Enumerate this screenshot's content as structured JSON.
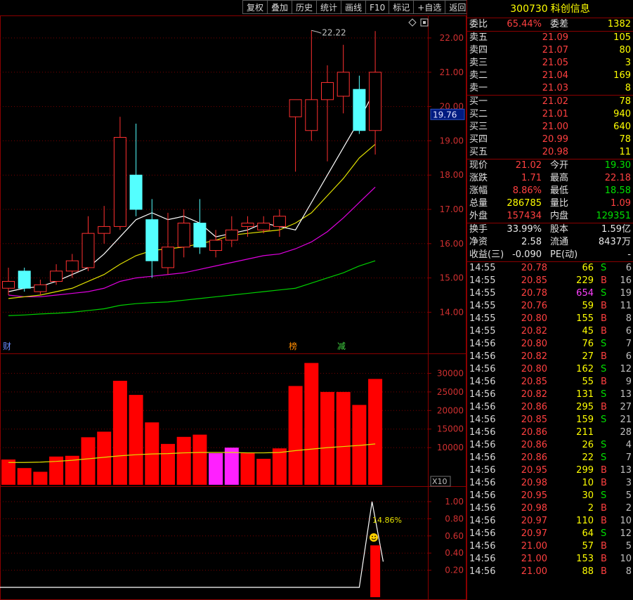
{
  "toolbar": {
    "buttons": [
      "复权",
      "叠加",
      "历史",
      "统计",
      "画线",
      "F10",
      "标记",
      "+自选",
      "返回"
    ]
  },
  "stock": {
    "code": "300730",
    "name": "科创信息"
  },
  "price_axis": {
    "labels": [
      "22.00",
      "21.00",
      "20.00",
      "19.00",
      "18.00",
      "17.00",
      "16.00",
      "15.00",
      "14.00"
    ],
    "current_marker": "19.76"
  },
  "volume_axis": {
    "labels": [
      "30000",
      "25000",
      "20000",
      "15000",
      "10000"
    ],
    "unit": "X10"
  },
  "indicator_axis": {
    "labels": [
      "1.00",
      "0.80",
      "0.60",
      "0.40",
      "0.20"
    ]
  },
  "annotations": {
    "high_label": "22.22",
    "indicator_value": "14.86%",
    "marker_cai": "财",
    "marker_bang": "榜",
    "marker_jian": "减"
  },
  "chart_data": {
    "type": "candlestick",
    "ylim": [
      13.0,
      22.6
    ],
    "candles": [
      {
        "o": 14.7,
        "c": 14.9,
        "h": 15.3,
        "l": 14.5
      },
      {
        "o": 15.2,
        "c": 14.7,
        "h": 15.3,
        "l": 14.6
      },
      {
        "o": 14.6,
        "c": 14.8,
        "h": 14.95,
        "l": 14.5
      },
      {
        "o": 14.9,
        "c": 15.2,
        "h": 15.4,
        "l": 14.8
      },
      {
        "o": 15.2,
        "c": 15.5,
        "h": 15.7,
        "l": 15.0
      },
      {
        "o": 15.3,
        "c": 16.3,
        "h": 16.8,
        "l": 15.2
      },
      {
        "o": 16.3,
        "c": 16.5,
        "h": 17.1,
        "l": 16.0
      },
      {
        "o": 16.5,
        "c": 19.1,
        "h": 19.7,
        "l": 16.4
      },
      {
        "o": 18.0,
        "c": 17.0,
        "h": 19.5,
        "l": 16.8
      },
      {
        "o": 16.7,
        "c": 15.5,
        "h": 17.3,
        "l": 15.0
      },
      {
        "o": 15.3,
        "c": 15.9,
        "h": 16.9,
        "l": 15.1
      },
      {
        "o": 15.9,
        "c": 16.6,
        "h": 17.0,
        "l": 15.6
      },
      {
        "o": 16.6,
        "c": 15.9,
        "h": 17.3,
        "l": 15.7
      },
      {
        "o": 15.8,
        "c": 16.1,
        "h": 16.4,
        "l": 15.6
      },
      {
        "o": 16.1,
        "c": 16.4,
        "h": 16.8,
        "l": 15.9
      },
      {
        "o": 16.5,
        "c": 16.6,
        "h": 16.8,
        "l": 16.2
      },
      {
        "o": 16.4,
        "c": 16.6,
        "h": 16.8,
        "l": 16.3
      },
      {
        "o": 16.5,
        "c": 16.8,
        "h": 17.0,
        "l": 16.2
      },
      {
        "o": 19.7,
        "c": 20.2,
        "h": 20.2,
        "l": 18.1
      },
      {
        "o": 19.3,
        "c": 20.2,
        "h": 22.22,
        "l": 19.0
      },
      {
        "o": 20.2,
        "c": 20.7,
        "h": 21.2,
        "l": 18.4
      },
      {
        "o": 20.3,
        "c": 21.0,
        "h": 21.8,
        "l": 19.8
      },
      {
        "o": 20.5,
        "c": 19.3,
        "h": 20.9,
        "l": 19.2
      },
      {
        "o": 19.3,
        "c": 21.0,
        "h": 22.2,
        "l": 18.6
      }
    ],
    "ma_fast": [
      14.6,
      14.7,
      14.75,
      14.9,
      15.1,
      15.3,
      15.7,
      16.2,
      16.7,
      16.9,
      16.7,
      16.8,
      16.6,
      16.2,
      16.3,
      16.4,
      16.6,
      16.5,
      16.4,
      17.2,
      18.0,
      18.8,
      19.6,
      20.5
    ],
    "ma_mid": [
      14.4,
      14.45,
      14.5,
      14.6,
      14.7,
      14.9,
      15.1,
      15.4,
      15.65,
      15.8,
      15.85,
      15.9,
      16.0,
      16.1,
      16.25,
      16.3,
      16.35,
      16.4,
      16.6,
      16.9,
      17.4,
      17.9,
      18.5,
      18.9
    ],
    "ma_slow": [
      14.5,
      14.45,
      14.45,
      14.5,
      14.55,
      14.6,
      14.7,
      14.9,
      15.0,
      15.05,
      15.1,
      15.15,
      15.25,
      15.35,
      15.45,
      15.55,
      15.65,
      15.7,
      15.85,
      16.05,
      16.35,
      16.75,
      17.2,
      17.65
    ],
    "ma_long": [
      13.9,
      13.92,
      13.95,
      13.97,
      14.0,
      14.05,
      14.1,
      14.2,
      14.25,
      14.28,
      14.3,
      14.35,
      14.4,
      14.45,
      14.5,
      14.55,
      14.6,
      14.65,
      14.7,
      14.85,
      15.0,
      15.15,
      15.35,
      15.5
    ],
    "volumes": [
      6800,
      4500,
      3500,
      7600,
      7800,
      12800,
      14300,
      28000,
      24200,
      16800,
      11000,
      12900,
      13500,
      8500,
      10000,
      8500,
      7000,
      9800,
      26600,
      32800,
      25000,
      25000,
      21500,
      28500
    ],
    "vol_colors": [
      "red",
      "red",
      "red",
      "red",
      "red",
      "red",
      "red",
      "red",
      "red",
      "red",
      "red",
      "red",
      "red",
      "mag",
      "mag",
      "red",
      "red",
      "red",
      "red",
      "red",
      "red",
      "red",
      "red",
      "red"
    ],
    "vol_ma": [
      6000,
      6000,
      6100,
      6300,
      6600,
      7000,
      7400,
      7800,
      8100,
      8300,
      8400,
      8600,
      8700,
      8700,
      8700,
      8600,
      8600,
      8700,
      9200,
      9600,
      10000,
      10300,
      10600,
      11000
    ],
    "vol_ylim": [
      0,
      35000
    ],
    "indicator_ylim": [
      0,
      1.1
    ],
    "indicator_line": [
      [
        22,
        0
      ],
      [
        22.8,
        1.0
      ],
      [
        23.5,
        0.3
      ]
    ],
    "indicator_bar": 0.49
  },
  "side": {
    "weibi": {
      "label": "委比",
      "value": "65.44%",
      "label2": "委差",
      "value2": "1382"
    },
    "sells": [
      {
        "label": "卖五",
        "price": "21.09",
        "vol": "105"
      },
      {
        "label": "卖四",
        "price": "21.07",
        "vol": "80"
      },
      {
        "label": "卖三",
        "price": "21.05",
        "vol": "3"
      },
      {
        "label": "卖二",
        "price": "21.04",
        "vol": "169"
      },
      {
        "label": "卖一",
        "price": "21.03",
        "vol": "8"
      }
    ],
    "buys": [
      {
        "label": "买一",
        "price": "21.02",
        "vol": "78"
      },
      {
        "label": "买二",
        "price": "21.01",
        "vol": "940"
      },
      {
        "label": "买三",
        "price": "21.00",
        "vol": "640"
      },
      {
        "label": "买四",
        "price": "20.99",
        "vol": "78"
      },
      {
        "label": "买五",
        "price": "20.98",
        "vol": "11"
      }
    ],
    "quote": [
      {
        "l1": "现价",
        "v1": "21.02",
        "l2": "今开",
        "v2": "19.30",
        "c1": "red",
        "c2": "grn"
      },
      {
        "l1": "涨跌",
        "v1": "1.71",
        "l2": "最高",
        "v2": "22.18",
        "c1": "red",
        "c2": "red"
      },
      {
        "l1": "涨幅",
        "v1": "8.86%",
        "l2": "最低",
        "v2": "18.58",
        "c1": "red",
        "c2": "grn"
      },
      {
        "l1": "总量",
        "v1": "286785",
        "l2": "量比",
        "v2": "1.09",
        "c1": "yel",
        "c2": "red"
      },
      {
        "l1": "外盘",
        "v1": "157434",
        "l2": "内盘",
        "v2": "129351",
        "c1": "red",
        "c2": "grn"
      }
    ],
    "extra": [
      {
        "l1": "换手",
        "v1": "33.99%",
        "l2": "股本",
        "v2": "1.59亿"
      },
      {
        "l1": "净资",
        "v1": "2.58",
        "l2": "流通",
        "v2": "8437万"
      },
      {
        "l1": "收益(三)",
        "v1": "-0.090",
        "l2": "PE(动)",
        "v2": "-"
      }
    ],
    "ticks": [
      {
        "t": "14:55",
        "p": "20.78",
        "v": "66",
        "f": "S",
        "n": "6",
        "vc": "yel"
      },
      {
        "t": "14:55",
        "p": "20.85",
        "v": "229",
        "f": "B",
        "n": "16",
        "vc": "yel"
      },
      {
        "t": "14:55",
        "p": "20.78",
        "v": "654",
        "f": "S",
        "n": "19",
        "vc": "mag"
      },
      {
        "t": "14:55",
        "p": "20.76",
        "v": "59",
        "f": "B",
        "n": "11",
        "vc": "yel"
      },
      {
        "t": "14:55",
        "p": "20.80",
        "v": "155",
        "f": "B",
        "n": "8",
        "vc": "yel"
      },
      {
        "t": "14:55",
        "p": "20.82",
        "v": "45",
        "f": "B",
        "n": "6",
        "vc": "yel"
      },
      {
        "t": "14:56",
        "p": "20.80",
        "v": "76",
        "f": "S",
        "n": "7",
        "vc": "yel"
      },
      {
        "t": "14:56",
        "p": "20.82",
        "v": "27",
        "f": "B",
        "n": "6",
        "vc": "yel"
      },
      {
        "t": "14:56",
        "p": "20.80",
        "v": "162",
        "f": "S",
        "n": "12",
        "vc": "yel"
      },
      {
        "t": "14:56",
        "p": "20.85",
        "v": "55",
        "f": "B",
        "n": "9",
        "vc": "yel"
      },
      {
        "t": "14:56",
        "p": "20.82",
        "v": "131",
        "f": "S",
        "n": "13",
        "vc": "yel"
      },
      {
        "t": "14:56",
        "p": "20.86",
        "v": "295",
        "f": "B",
        "n": "27",
        "vc": "yel"
      },
      {
        "t": "14:56",
        "p": "20.85",
        "v": "159",
        "f": "S",
        "n": "21",
        "vc": "yel"
      },
      {
        "t": "14:56",
        "p": "20.86",
        "v": "211",
        "f": "",
        "n": "28",
        "vc": "yel"
      },
      {
        "t": "14:56",
        "p": "20.86",
        "v": "26",
        "f": "S",
        "n": "4",
        "vc": "yel"
      },
      {
        "t": "14:56",
        "p": "20.86",
        "v": "22",
        "f": "S",
        "n": "7",
        "vc": "yel"
      },
      {
        "t": "14:56",
        "p": "20.95",
        "v": "299",
        "f": "B",
        "n": "13",
        "vc": "yel"
      },
      {
        "t": "14:56",
        "p": "20.98",
        "v": "10",
        "f": "B",
        "n": "3",
        "vc": "yel"
      },
      {
        "t": "14:56",
        "p": "20.95",
        "v": "30",
        "f": "S",
        "n": "5",
        "vc": "yel"
      },
      {
        "t": "14:56",
        "p": "20.98",
        "v": "2",
        "f": "B",
        "n": "2",
        "vc": "yel"
      },
      {
        "t": "14:56",
        "p": "20.97",
        "v": "110",
        "f": "B",
        "n": "10",
        "vc": "yel"
      },
      {
        "t": "14:56",
        "p": "20.97",
        "v": "64",
        "f": "S",
        "n": "12",
        "vc": "yel"
      },
      {
        "t": "14:56",
        "p": "21.00",
        "v": "57",
        "f": "B",
        "n": "5",
        "vc": "yel"
      },
      {
        "t": "14:56",
        "p": "21.00",
        "v": "153",
        "f": "B",
        "n": "10",
        "vc": "yel"
      },
      {
        "t": "14:56",
        "p": "21.00",
        "v": "88",
        "f": "B",
        "n": "8",
        "vc": "yel"
      }
    ]
  }
}
